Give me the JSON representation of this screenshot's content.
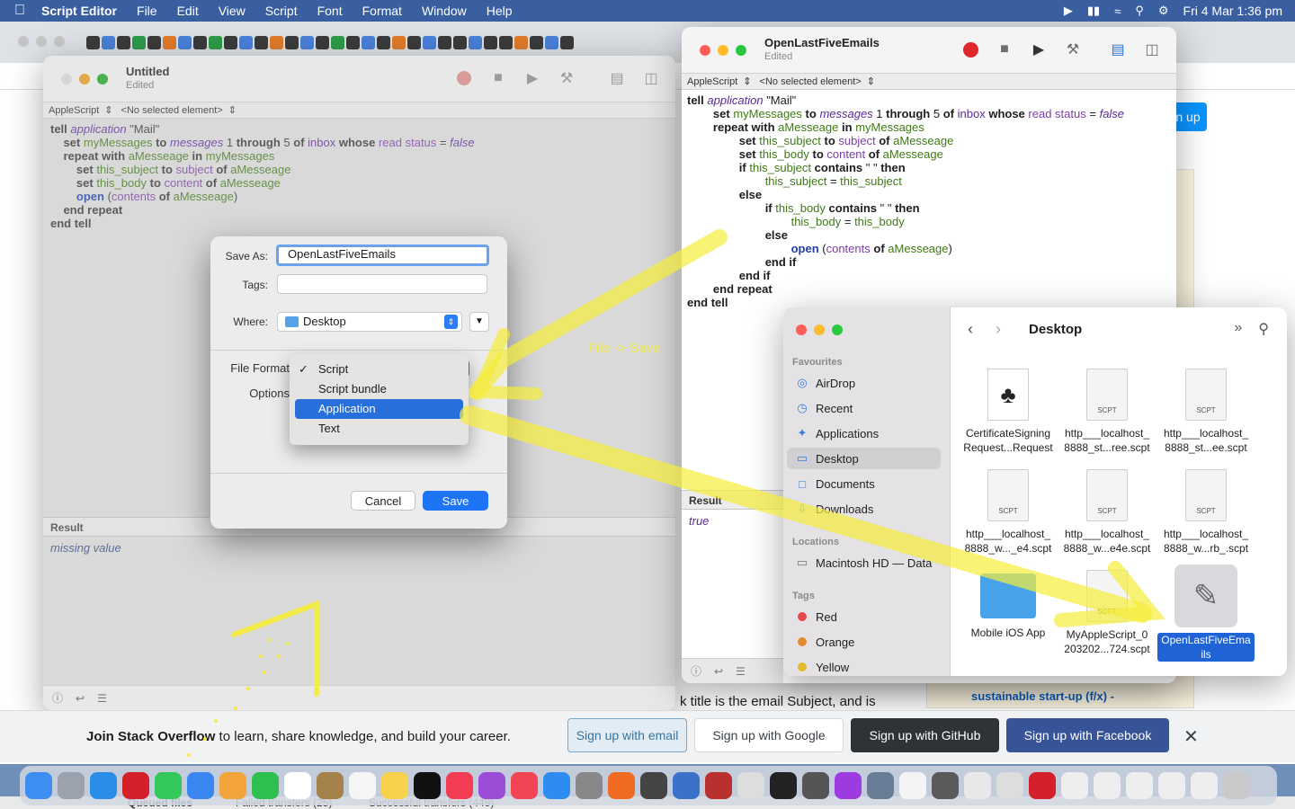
{
  "menubar": {
    "app_name": "Script Editor",
    "items": [
      "File",
      "Edit",
      "View",
      "Script",
      "Font",
      "Format",
      "Window",
      "Help"
    ],
    "clock": "Fri 4 Mar  1:36 pm"
  },
  "untitled_window": {
    "title": "Untitled",
    "subtitle": "Edited",
    "nav_language": "AppleScript",
    "nav_element": "<No selected element>",
    "result_label": "Result",
    "result_value": "missing value"
  },
  "save_dialog": {
    "save_as_label": "Save As:",
    "save_as_value": "OpenLastFiveEmails",
    "tags_label": "Tags:",
    "where_label": "Where:",
    "where_value": "Desktop",
    "file_format_label": "File Format",
    "options_label": "Options",
    "cancel_label": "Cancel",
    "save_label": "Save",
    "format_options": [
      "Script",
      "Script bundle",
      "Application",
      "Text"
    ],
    "checked_option": "Script",
    "highlighted_option": "Application"
  },
  "script_window": {
    "title": "OpenLastFiveEmails",
    "subtitle": "Edited",
    "nav_language": "AppleScript",
    "nav_element": "<No selected element>",
    "result_label": "Result",
    "result_value": "true"
  },
  "annotation": {
    "label": "File -> Save"
  },
  "finder": {
    "title": "Desktop",
    "favourites_label": "Favourites",
    "favourites": [
      "AirDrop",
      "Recent",
      "Applications",
      "Desktop",
      "Documents",
      "Downloads"
    ],
    "locations_label": "Locations",
    "locations": [
      "Macintosh HD — Data"
    ],
    "tags_label": "Tags",
    "tags": [
      {
        "name": "Red",
        "color": "#e5484d"
      },
      {
        "name": "Orange",
        "color": "#e38a33"
      },
      {
        "name": "Yellow",
        "color": "#e3b92f"
      }
    ],
    "files": [
      {
        "name": "CertificateSigning Request...Request"
      },
      {
        "name": "http___localhost_ 8888_st...ree.scpt"
      },
      {
        "name": "http___localhost_ 8888_st...ee.scpt"
      },
      {
        "name": "http___localhost_ 8888_w..._e4.scpt"
      },
      {
        "name": "http___localhost_ 8888_w...e4e.scpt"
      },
      {
        "name": "http___localhost_ 8888_w...rb_.scpt"
      },
      {
        "name": "Mobile iOS App"
      },
      {
        "name": "MyAppleScript_0 203202...724.scpt"
      },
      {
        "name": "OpenLastFiveEma ils"
      }
    ],
    "doc_badge": "SCPT"
  },
  "stackoverflow_banner": {
    "message_bold": "Join Stack Overflow",
    "message_rest": " to learn, share knowledge, and build your career.",
    "email_button": "Sign up with email",
    "google_button": "Sign up with Google",
    "github_button": "Sign up with GitHub",
    "facebook_button": "Sign up with Facebook"
  },
  "browser_fragments": {
    "signup_small": "n up",
    "sidebar_link": "sustainable start-up (f/x) -",
    "snippet": "k title is the email Subject, and is"
  },
  "bottom_strip": {
    "queued": "Queued files",
    "failed": "Failed transfers (25)",
    "success": "Successful transfers (449)"
  },
  "colors": {
    "accent": "#1d74f5",
    "highlighter": "#f5ec3a",
    "selection": "#2770dc"
  }
}
